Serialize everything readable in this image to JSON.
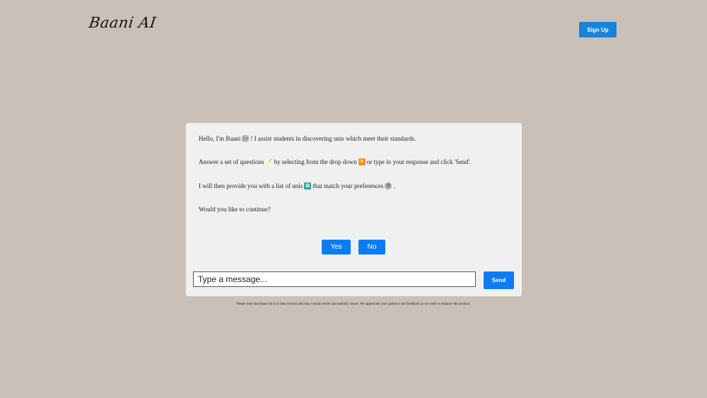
{
  "header": {
    "logo_text": "Baani AI",
    "signup_label": "Sign Up"
  },
  "chat": {
    "line1": {
      "before": "Hello, I'm Baani",
      "emoji": "🤖",
      "after": "! I assist students in discovering unis which meet their standards."
    },
    "line2": {
      "part1": "Answer a set of questions",
      "emoji1": "📝",
      "part2": "by selecting from the drop down",
      "emoji2": "🔽",
      "part3": "or type in your response and click 'Send'."
    },
    "line3": {
      "before": "I will then provide you with a list of unis",
      "emoji1": "🏛",
      "middle": "that match your preferences",
      "emoji2": "⚙",
      "after": "."
    },
    "line4": "Would you like to continue?",
    "options": {
      "yes": "Yes",
      "no": "No"
    }
  },
  "composer": {
    "placeholder": "Type a message...",
    "send_label": "Send"
  },
  "footer": {
    "disclaimer": "Please note that Baani AI is in beta version and may contain errors and stability issues. We appreciate your patience and feedback as we work to enhance the product."
  },
  "colors": {
    "background": "#cbc0b7",
    "accent": "#0a7cf5",
    "signup": "#1a82d9",
    "card": "#f0f0f0"
  }
}
